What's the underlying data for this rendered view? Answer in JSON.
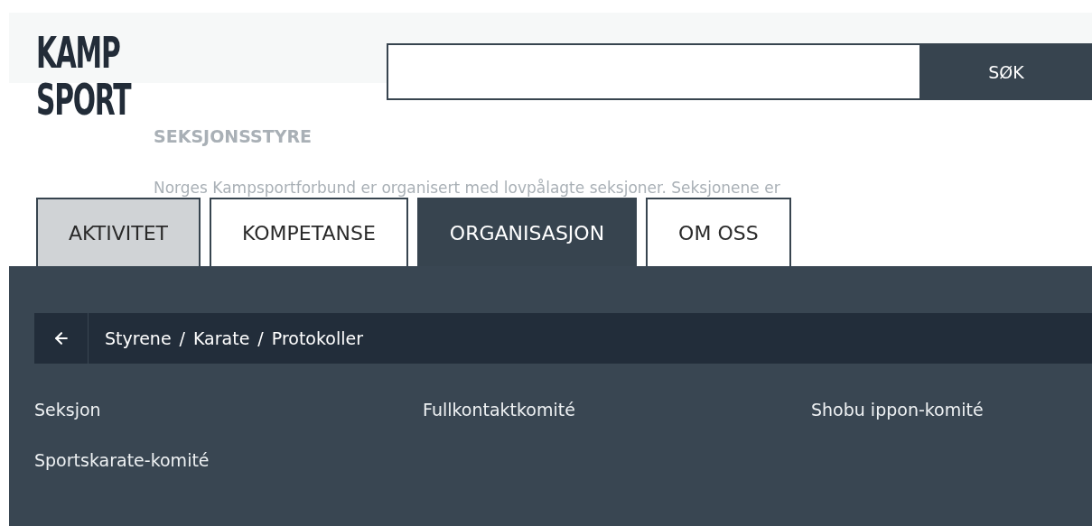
{
  "logo": {
    "lines": [
      "KAMP",
      "SPORT"
    ]
  },
  "search": {
    "button": "SØK"
  },
  "background_card": {
    "heading": "SEKSJONSSTYRE",
    "text": "Norges Kampsportforbund er organisert med lovpålagte seksjoner. Seksjonene er"
  },
  "tabs": [
    {
      "label": "AKTIVITET",
      "selected": false,
      "highlighted": true
    },
    {
      "label": "KOMPETANSE",
      "selected": false,
      "highlighted": false
    },
    {
      "label": "ORGANISASJON",
      "selected": true,
      "highlighted": false
    },
    {
      "label": "OM OSS",
      "selected": false,
      "highlighted": false
    }
  ],
  "breadcrumb": {
    "separator": "/",
    "items": [
      "Styrene",
      "Karate",
      "Protokoller"
    ]
  },
  "links": [
    "Seksjon",
    "Fullkontaktkomité",
    "Shobu ippon-komité",
    "Sportskarate-komité"
  ]
}
